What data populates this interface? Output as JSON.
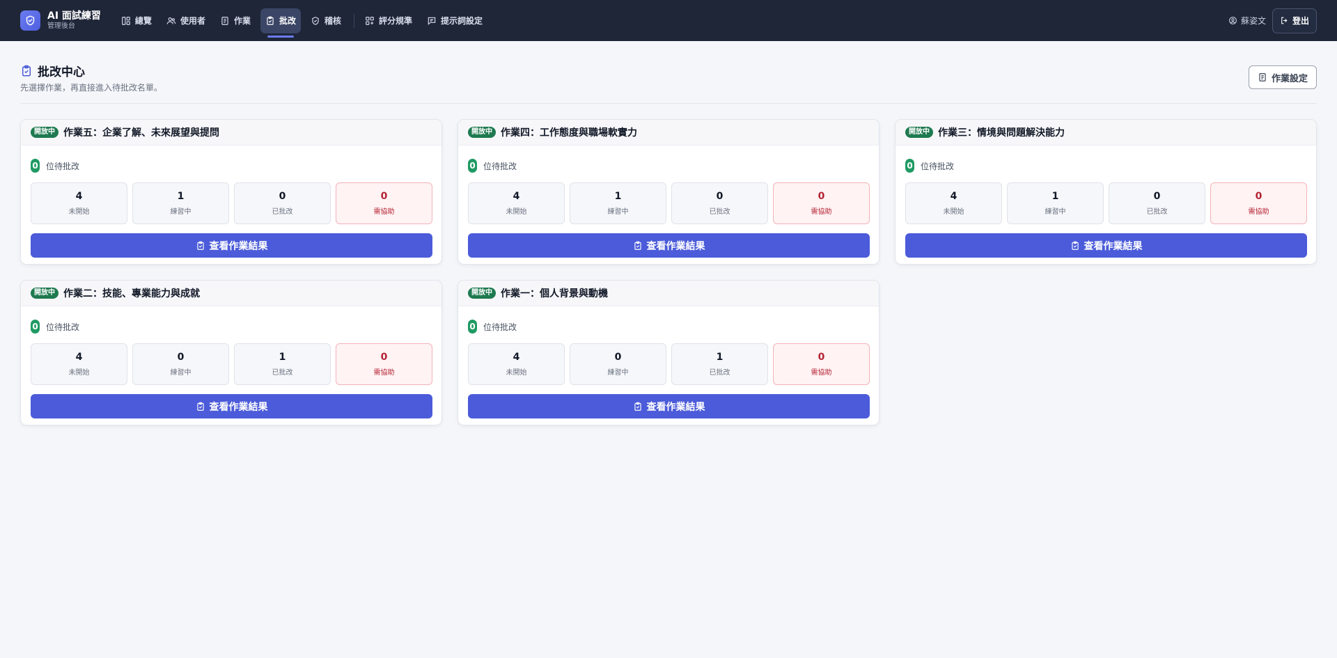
{
  "app": {
    "title": "AI 面試練習",
    "subtitle": "管理後台",
    "logo_icon": "shield-check-icon",
    "accent": "#4b5bd9",
    "navbar_bg": "#1e2638"
  },
  "nav": {
    "items": [
      {
        "label": "總覽",
        "icon": "dashboard-icon",
        "active": false
      },
      {
        "label": "使用者",
        "icon": "users-icon",
        "active": false
      },
      {
        "label": "作業",
        "icon": "document-icon",
        "active": false
      },
      {
        "label": "批改",
        "icon": "clipboard-check-icon",
        "active": true
      },
      {
        "label": "稽核",
        "icon": "shield-icon",
        "active": false
      },
      {
        "label": "評分規準",
        "icon": "grid-icon",
        "active": false
      },
      {
        "label": "提示詞設定",
        "icon": "message-icon",
        "active": false
      }
    ],
    "user_name": "蘇姿文",
    "logout_label": "登出"
  },
  "page": {
    "title": "批改中心",
    "subtitle": "先選擇作業，再直接進入待批改名單。",
    "settings_label": "作業設定"
  },
  "card_labels": {
    "pending_suffix": "位待批改",
    "not_started": "未開始",
    "practicing": "練習中",
    "graded": "已批改",
    "needs_help": "需協助",
    "view_button": "查看作業結果"
  },
  "assignments": [
    {
      "status": "開放中",
      "title": "作業五：企業了解、未來展望與提問",
      "pending": "0",
      "not_started": "4",
      "practicing": "1",
      "graded": "0",
      "needs_help": "0"
    },
    {
      "status": "開放中",
      "title": "作業四：工作態度與職場軟實力",
      "pending": "0",
      "not_started": "4",
      "practicing": "1",
      "graded": "0",
      "needs_help": "0"
    },
    {
      "status": "開放中",
      "title": "作業三：情境與問題解決能力",
      "pending": "0",
      "not_started": "4",
      "practicing": "1",
      "graded": "0",
      "needs_help": "0"
    },
    {
      "status": "開放中",
      "title": "作業二：技能、專業能力與成就",
      "pending": "0",
      "not_started": "4",
      "practicing": "0",
      "graded": "1",
      "needs_help": "0"
    },
    {
      "status": "開放中",
      "title": "作業一：個人背景與動機",
      "pending": "0",
      "not_started": "4",
      "practicing": "0",
      "graded": "1",
      "needs_help": "0"
    }
  ]
}
